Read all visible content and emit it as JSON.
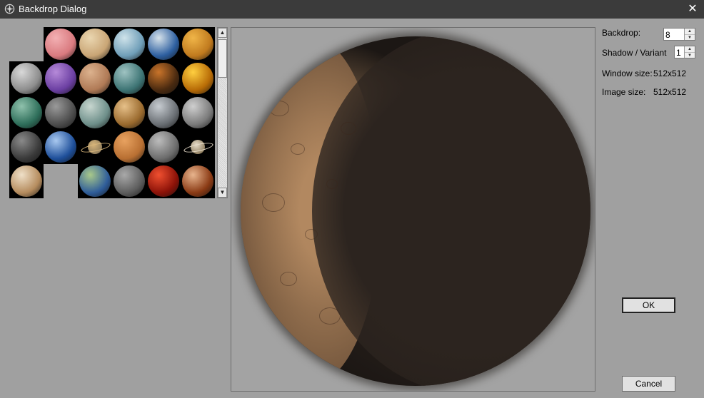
{
  "window": {
    "title": "Backdrop Dialog",
    "close_glyph": "✕",
    "app_icon": "app-logo-icon"
  },
  "thumbnails": {
    "grid_cells": [
      {
        "row": 0,
        "col": 1,
        "color": "#d97a7f",
        "accent": "#f3b0b3"
      },
      {
        "row": 0,
        "col": 2,
        "color": "#c9a575",
        "accent": "#ead6b0"
      },
      {
        "row": 0,
        "col": 3,
        "color": "#6f9eb8",
        "accent": "#cfe3ea"
      },
      {
        "row": 0,
        "col": 4,
        "color": "#2d5fa0",
        "accent": "#d7e2ea"
      },
      {
        "row": 0,
        "col": 5,
        "color": "#c07a1e",
        "accent": "#f0b548"
      },
      {
        "row": 1,
        "col": 0,
        "color": "#8d8d8d",
        "accent": "#d9d9d9"
      },
      {
        "row": 1,
        "col": 1,
        "color": "#6b3fa2",
        "accent": "#b68ad9"
      },
      {
        "row": 1,
        "col": 2,
        "color": "#b07a56",
        "accent": "#dcb28e"
      },
      {
        "row": 1,
        "col": 3,
        "color": "#3d7474",
        "accent": "#9fc3c2"
      },
      {
        "row": 1,
        "col": 4,
        "color": "#4a2a10",
        "accent": "#c9742a"
      },
      {
        "row": 1,
        "col": 5,
        "color": "#b76b06",
        "accent": "#ffcf40"
      },
      {
        "row": 2,
        "col": 0,
        "color": "#2e6e5a",
        "accent": "#8fc1ac"
      },
      {
        "row": 2,
        "col": 1,
        "color": "#4d4d4d",
        "accent": "#9a9a9a"
      },
      {
        "row": 2,
        "col": 2,
        "color": "#6e8f8a",
        "accent": "#c7d6cf"
      },
      {
        "row": 2,
        "col": 3,
        "color": "#9a6a2e",
        "accent": "#e6c089"
      },
      {
        "row": 2,
        "col": 4,
        "color": "#6a6f74",
        "accent": "#c7ccd1"
      },
      {
        "row": 2,
        "col": 5,
        "color": "#7b7b7b",
        "accent": "#cfcfcf"
      },
      {
        "row": 3,
        "col": 0,
        "color": "#3a3a3a",
        "accent": "#8a8a8a"
      },
      {
        "row": 3,
        "col": 1,
        "color": "#1e4f9a",
        "accent": "#a9c9f0"
      },
      {
        "row": 3,
        "col": 2,
        "color": "#000000",
        "accent": "#d7b57a",
        "ring": true
      },
      {
        "row": 3,
        "col": 3,
        "color": "#b86f32",
        "accent": "#e8a260"
      },
      {
        "row": 3,
        "col": 4,
        "color": "#6d6d6d",
        "accent": "#bcbcbc"
      },
      {
        "row": 3,
        "col": 5,
        "color": "#000000",
        "accent": "#e6dbc8",
        "ring": true
      },
      {
        "row": 4,
        "col": 0,
        "color": "#b58c5e",
        "accent": "#efe0c8"
      },
      {
        "row": 4,
        "col": 2,
        "color": "#2f5d9a",
        "accent": "#a9c98a"
      },
      {
        "row": 4,
        "col": 3,
        "color": "#5d5d5d",
        "accent": "#a9a9a9"
      },
      {
        "row": 4,
        "col": 4,
        "color": "#8c1208",
        "accent": "#f05030"
      },
      {
        "row": 4,
        "col": 5,
        "color": "#8a3a14",
        "accent": "#e8b58e"
      }
    ]
  },
  "settings": {
    "backdrop_label": "Backdrop:",
    "backdrop_value": "8",
    "shadow_label": "Shadow / Variant",
    "shadow_value": "1",
    "window_size_label": "Window size:",
    "window_size_value": "512x512",
    "image_size_label": "Image size:",
    "image_size_value": "512x512"
  },
  "buttons": {
    "ok": "OK",
    "cancel": "Cancel"
  },
  "scrollbar": {
    "up_glyph": "▲",
    "down_glyph": "▼"
  }
}
